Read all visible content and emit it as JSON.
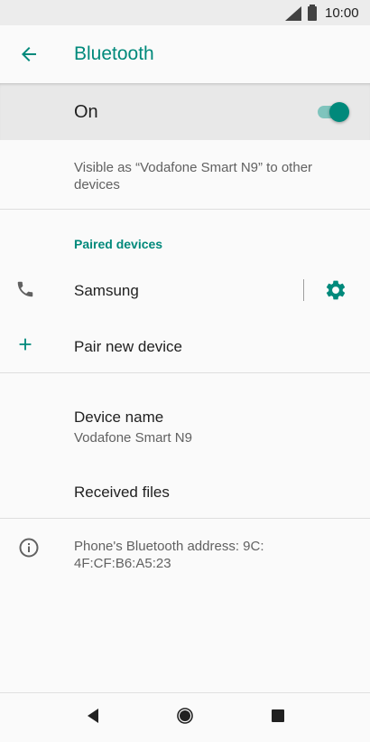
{
  "status_bar": {
    "time": "10:00"
  },
  "app_bar": {
    "title": "Bluetooth"
  },
  "master_switch": {
    "label": "On",
    "enabled": true
  },
  "visibility_text": "Visible as “Vodafone Smart N9” to other devices",
  "paired_devices": {
    "header": "Paired devices",
    "items": [
      {
        "name": "Samsung"
      }
    ]
  },
  "pair_new": {
    "label": "Pair new device"
  },
  "device_name": {
    "label": "Device name",
    "value": "Vodafone Smart N9"
  },
  "received_files": {
    "label": "Received files"
  },
  "bluetooth_address": {
    "text": "Phone's Bluetooth address: 9C:\n4F:CF:B6:A5:23"
  },
  "colors": {
    "accent": "#00897b",
    "toggle_track": "#7fc4bd",
    "switch_bg": "#e8e8e8"
  },
  "icons": [
    "back-arrow-icon",
    "phone-icon",
    "gear-icon",
    "plus-icon",
    "info-icon"
  ]
}
